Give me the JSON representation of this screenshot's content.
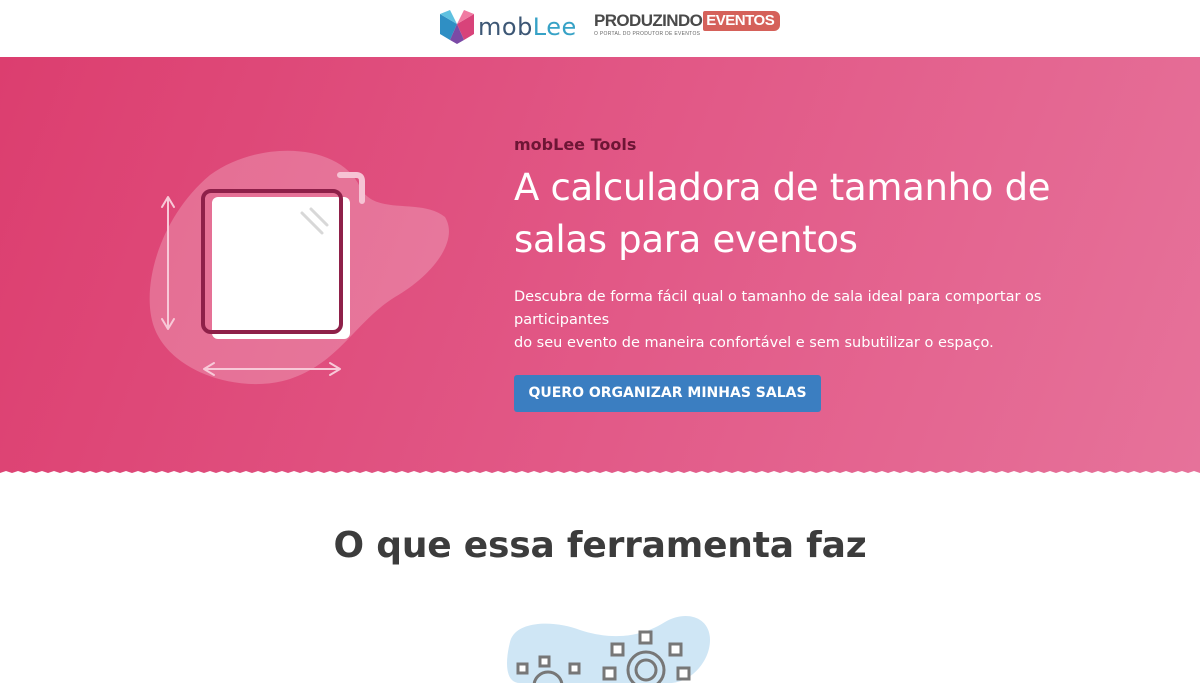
{
  "header": {
    "moblee_logo": {
      "word_left": "mob",
      "word_right": "Lee"
    },
    "partner_logo": {
      "word": "PRODUZINDO",
      "tag": "EVENTOS",
      "tagline": "O PORTAL DO PRODUTOR DE EVENTOS"
    }
  },
  "hero": {
    "eyebrow": "mobLee Tools",
    "title_line1": "A calculadora de tamanho de",
    "title_line2": "salas para eventos",
    "description_line1": "Descubra de forma fácil qual o tamanho de sala ideal para comportar os participantes",
    "description_line2": "do seu evento de maneira confortável e sem subutilizar o espaço.",
    "cta_label": "QUERO ORGANIZAR MINHAS SALAS"
  },
  "features": {
    "section_title": "O que essa ferramenta faz"
  },
  "colors": {
    "hero_gradient_start": "#dc3e6f",
    "hero_gradient_end": "#e6729a",
    "cta_blue": "#3b7ec1",
    "eyebrow_dark": "#6e1535",
    "room_outline": "#8e2049",
    "partner_tag": "#d5615a"
  },
  "icons": {
    "moblee_mark": "moblee-logo-icon",
    "room_square": "room-square-icon",
    "vertical_arrow": "vertical-double-arrow-icon",
    "horizontal_arrow": "horizontal-double-arrow-icon",
    "gear_cluster": "gears-icon"
  }
}
